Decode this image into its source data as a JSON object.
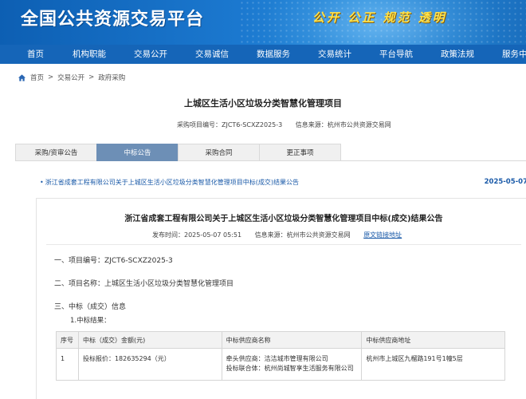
{
  "header": {
    "site_title": "全国公共资源交易平台",
    "slogan": "公开 公正 规范 透明",
    "brand_color": "#1565b8",
    "accent_color": "#ffe24a"
  },
  "nav": {
    "items": [
      {
        "label": "首页"
      },
      {
        "label": "机构职能"
      },
      {
        "label": "交易公开"
      },
      {
        "label": "交易诚信"
      },
      {
        "label": "数据服务"
      },
      {
        "label": "交易统计"
      },
      {
        "label": "平台导航"
      },
      {
        "label": "政策法规"
      },
      {
        "label": "服务中"
      }
    ]
  },
  "breadcrumb": {
    "icon": "home-icon",
    "items": [
      "首页",
      "交易公开",
      "政府采购"
    ],
    "separator": ">"
  },
  "project": {
    "title": "上城区生活小区垃圾分类智慧化管理项目",
    "code_text": "采购项目编号：ZJCT6-SCXZ2025-3",
    "source_text": "信息来源：杭州市公共资源交易网"
  },
  "tabs": [
    {
      "label": "采购/资审公告",
      "active": false
    },
    {
      "label": "中标公告",
      "active": true
    },
    {
      "label": "采购合同",
      "active": false
    },
    {
      "label": "更正事项",
      "active": false
    }
  ],
  "announcement": {
    "link_text": "浙江省成套工程有限公司关于上城区生活小区垃圾分类智慧化管理项目中标(成交)结果公告",
    "date": "2025-05-07"
  },
  "document": {
    "title": "浙江省成套工程有限公司关于上城区生活小区垃圾分类智慧化管理项目中标(成交)结果公告",
    "publish_time": "发布时间：2025-05-07 05:51",
    "source": "信息来源：杭州市公共资源交易网",
    "source_link": "原文链接地址",
    "sections": {
      "s1": "一、项目编号：ZJCT6-SCXZ2025-3",
      "s2": "二、项目名称：上城区生活小区垃圾分类智慧化管理项目",
      "s3": "三、中标（成交）信息",
      "s3_sub": "1.中标结果："
    },
    "table": {
      "headers": [
        "序号",
        "中标（成交）金额(元)",
        "中标供应商名称",
        "中标供应商地址"
      ],
      "rows": [
        {
          "no": "1",
          "amount": "投标报价：182635294（元）",
          "supplier_line1": "牵头供应商：洁洁城市管理有限公司",
          "supplier_line2": "投标联合体：杭州尚城智享生活服务有限公司",
          "address": "杭州市上城区九榴路191号1幢5层"
        }
      ]
    }
  }
}
